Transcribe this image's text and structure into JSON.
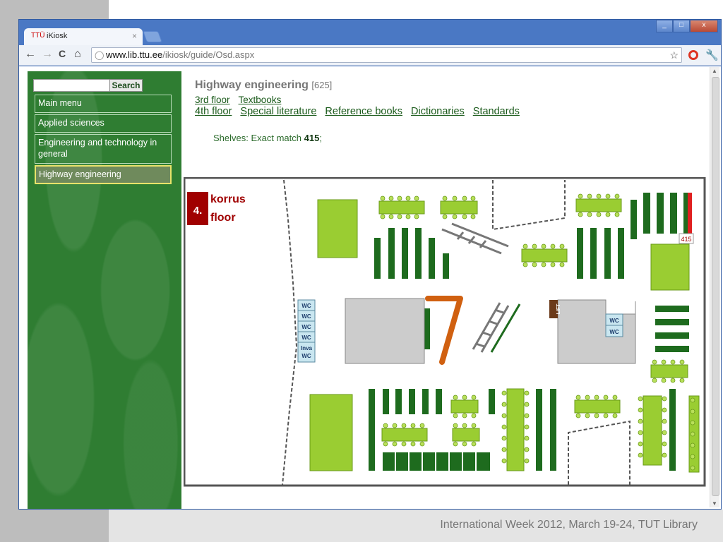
{
  "tab": {
    "title": "iKiosk",
    "close": "×",
    "favicon": "TTÜ"
  },
  "window": {
    "minimize": "_",
    "restore": "□",
    "close": "x"
  },
  "nav": {
    "back": "←",
    "forward": "→",
    "reload": "C",
    "home": "⌂"
  },
  "address": {
    "host": "www.lib.ttu.ee",
    "path": "/ikiosk/guide/Osd.aspx",
    "star": "☆",
    "wrench": "🔧"
  },
  "sidebar": {
    "search_placeholder": "",
    "search_button": "Search",
    "items": [
      {
        "label": "Main menu"
      },
      {
        "label": "Applied sciences"
      },
      {
        "label": "Engineering and technology in general"
      },
      {
        "label": "Highway engineering"
      }
    ]
  },
  "content": {
    "heading": "Highway engineering",
    "count": "[625]",
    "floor3_links": [
      "3rd floor",
      "Textbooks"
    ],
    "floor4_links": [
      "4th floor",
      "Special literature",
      "Reference books",
      "Dictionaries",
      "Standards"
    ],
    "shelves_prefix": "Shelves: Exact match ",
    "shelves_match": "415",
    "shelves_suffix": ";"
  },
  "floorplan": {
    "floor_number": "4.",
    "label_et": "korrus",
    "label_en": "floor",
    "shelf_tag": "415",
    "lift": "LIFT",
    "wc_left": [
      "WC",
      "WC",
      "WC",
      "WC"
    ],
    "wc_inva": [
      "Inva",
      "WC"
    ],
    "wc_right": [
      "WC",
      "WC"
    ],
    "stair_label": "7",
    "colors": {
      "shelf": "#1e6b1e",
      "table": "#9acd32",
      "highlight": "#e02020",
      "wall": "#555555",
      "room": "#cccccc",
      "floor_badge": "#a00000",
      "arrow": "#d06010"
    }
  },
  "footer": "International Week 2012, March 19-24, TUT Library"
}
